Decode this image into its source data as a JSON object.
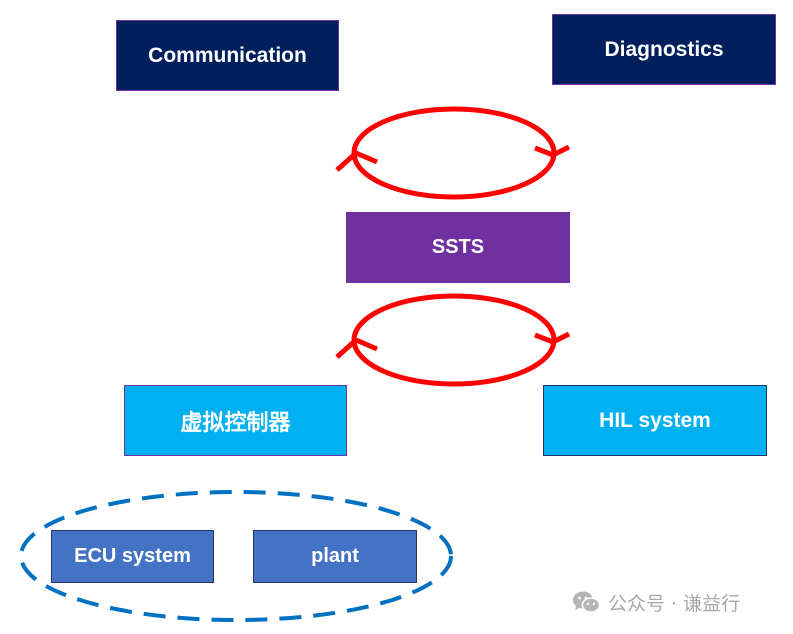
{
  "diagram": {
    "nodes": {
      "communication": {
        "label": "Communication",
        "color": "#001f5c"
      },
      "diagnostics": {
        "label": "Diagnostics",
        "color": "#001f5c"
      },
      "ssts": {
        "label": "SSTS",
        "color": "#7030a0"
      },
      "virtual_controller": {
        "label": "虚拟控制器",
        "color": "#00b0f0"
      },
      "hil_system": {
        "label": "HIL system",
        "color": "#00b0f0"
      },
      "ecu_system": {
        "label": "ECU system",
        "color": "#4472c4"
      },
      "plant": {
        "label": "plant",
        "color": "#4472c4"
      }
    },
    "cycles": [
      {
        "name": "upper-cycle",
        "between": [
          "communication/diagnostics",
          "ssts"
        ],
        "color": "#ff0000"
      },
      {
        "name": "lower-cycle",
        "between": [
          "ssts",
          "virtual-controller/hil-system"
        ],
        "color": "#ff0000"
      }
    ],
    "group": {
      "name": "ecu-plant-group",
      "members": [
        "ECU system",
        "plant"
      ],
      "style": "dashed",
      "color": "#0070c0"
    }
  },
  "watermark": {
    "icon": "wechat-icon",
    "text": "公众号 · 谦益行"
  }
}
